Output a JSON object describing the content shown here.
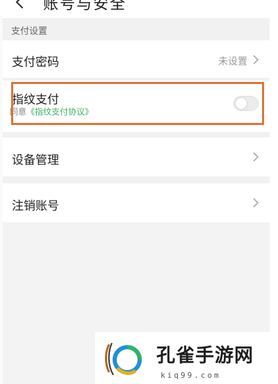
{
  "header": {
    "title": "账号与安全",
    "back_icon": "back-arrow-icon"
  },
  "section": {
    "label": "支付设置"
  },
  "rows": {
    "payment_password": {
      "title": "支付密码",
      "value": "未设置"
    },
    "fingerprint": {
      "title": "指纹支付",
      "agreement_prefix": "同意",
      "agreement_link": "《指纹支付协议》",
      "enabled": false
    },
    "device_management": {
      "title": "设备管理"
    },
    "cancel_account": {
      "title": "注销账号"
    }
  },
  "watermark": {
    "title": "孔雀手游网",
    "url": "kiq99.com"
  },
  "colors": {
    "highlight": "#d9773a",
    "link_green": "#3fae6a",
    "section_bg": "#f1f1f1"
  }
}
